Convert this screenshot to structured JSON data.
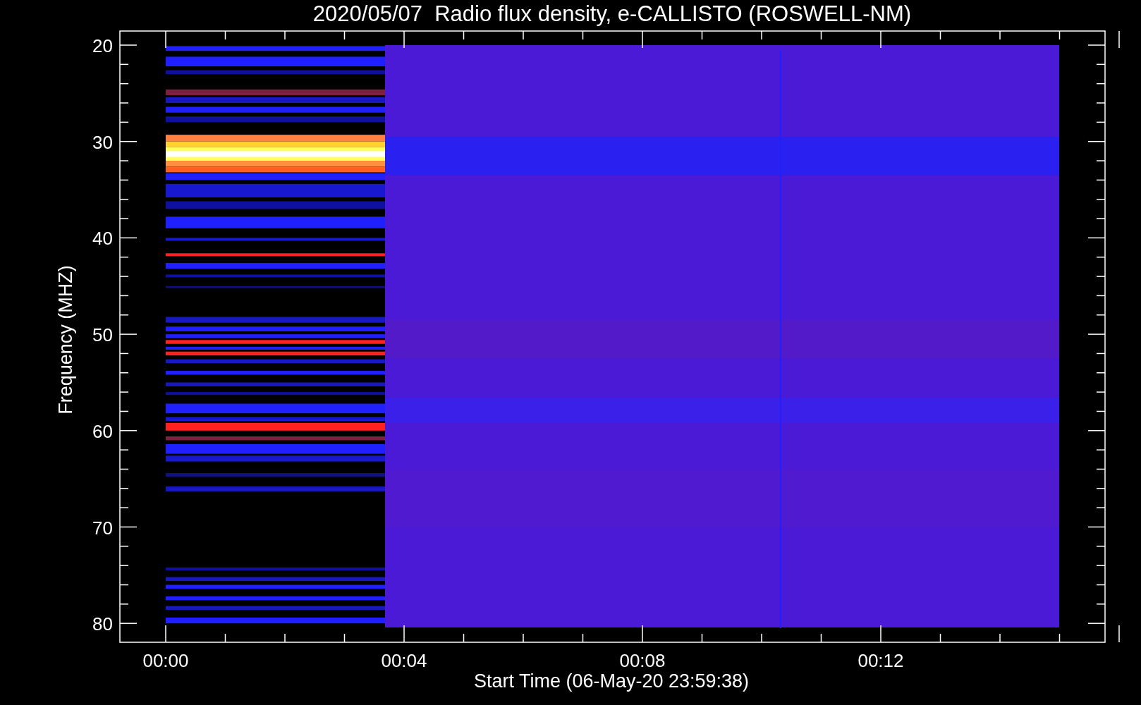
{
  "title": "2020/05/07  Radio flux density, e-CALLISTO (ROSWELL-NM)",
  "ylabel": "Frequency (MHZ)",
  "xlabel": "Start Time (06-May-20 23:59:38)",
  "yticks": [
    "20",
    "30",
    "40",
    "50",
    "60",
    "70",
    "80"
  ],
  "xticks": [
    "00:00",
    "00:04",
    "00:08",
    "00:12"
  ]
}
